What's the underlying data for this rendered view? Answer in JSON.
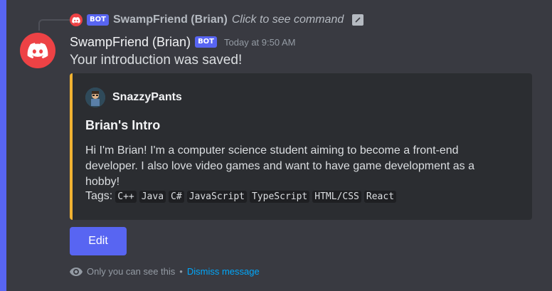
{
  "reply": {
    "bot_tag": "BOT",
    "name": "SwampFriend (Brian)",
    "command_hint": "Click to see command"
  },
  "message": {
    "username": "SwampFriend (Brian)",
    "bot_tag": "BOT",
    "timestamp": "Today at 9:50 AM",
    "content": "Your introduction was saved!"
  },
  "embed": {
    "accent_color": "#f0b232",
    "author": "SnazzyPants",
    "title": "Brian's Intro",
    "description": "Hi I'm Brian! I'm a computer science student aiming to become a front-end developer. I also love video games and want to have game development as a hobby!",
    "tags_label": "Tags:",
    "tags": [
      "C++",
      "Java",
      "C#",
      "JavaScript",
      "TypeScript",
      "HTML/CSS",
      "React"
    ]
  },
  "actions": {
    "edit_label": "Edit"
  },
  "ephemeral": {
    "icon": "eye-icon",
    "text": "Only you can see this",
    "separator": "•",
    "dismiss": "Dismiss message"
  },
  "colors": {
    "brand": "#5865f2",
    "avatar_bg": "#ed4245",
    "link": "#00a8fc"
  }
}
